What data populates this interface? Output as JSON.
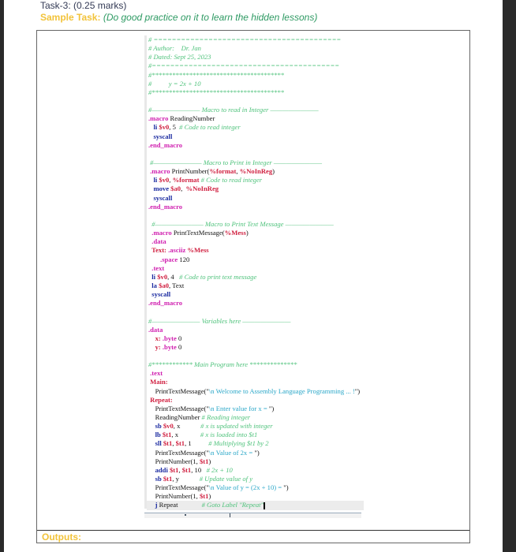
{
  "header": {
    "task_title": "Task-3: (0.25 marks)",
    "sample_label": "Sample Task:",
    "sample_note": "(Do good practice on it to learn the hidden lessons)"
  },
  "outputs_label": "Outputs:",
  "code_lines": [
    [
      [
        "c",
        "# ========================================="
      ]
    ],
    [
      [
        "c",
        "# Author:    Dr. Jan"
      ]
    ],
    [
      [
        "c",
        "# Dated: Sept 25, 2023"
      ]
    ],
    [
      [
        "c",
        "#========================================="
      ]
    ],
    [
      [
        "c",
        "#***************************************"
      ]
    ],
    [
      [
        "c",
        "#          y = 2x + 10"
      ]
    ],
    [
      [
        "c",
        "#***************************************"
      ]
    ],
    [],
    [
      [
        "c",
        "#———————— Macro to read in Integer ————————"
      ]
    ],
    [
      [
        "d",
        ".macro "
      ],
      [
        "p",
        "ReadingNumber"
      ]
    ],
    [
      [
        "p",
        "   "
      ],
      [
        "k",
        "li "
      ],
      [
        "r",
        "$v0"
      ],
      [
        "p",
        ", 5  "
      ],
      [
        "c",
        "# Code to read integer"
      ]
    ],
    [
      [
        "p",
        "   "
      ],
      [
        "k",
        "syscall"
      ]
    ],
    [
      [
        "d",
        ".end_macro"
      ]
    ],
    [],
    [
      [
        "c",
        " #———————— Macro to Print in Integer ————————"
      ]
    ],
    [
      [
        "d",
        " .macro "
      ],
      [
        "p",
        "PrintNumber("
      ],
      [
        "r",
        "%format"
      ],
      [
        "p",
        ", "
      ],
      [
        "r",
        "%NoInReg"
      ],
      [
        "p",
        ")"
      ]
    ],
    [
      [
        "p",
        "   "
      ],
      [
        "k",
        "li "
      ],
      [
        "r",
        "$v0"
      ],
      [
        "p",
        ", "
      ],
      [
        "r",
        "%format"
      ],
      [
        "c",
        " # Code to read integer"
      ]
    ],
    [
      [
        "p",
        "   "
      ],
      [
        "k",
        "move "
      ],
      [
        "r",
        "$a0"
      ],
      [
        "p",
        ",  "
      ],
      [
        "r",
        "%NoInReg"
      ]
    ],
    [
      [
        "p",
        "   "
      ],
      [
        "k",
        "syscall"
      ]
    ],
    [
      [
        "d",
        ".end_macro"
      ]
    ],
    [],
    [
      [
        "c",
        "  #———————— Macro to Print Text Message ————————"
      ]
    ],
    [
      [
        "d",
        "  .macro "
      ],
      [
        "p",
        "PrintTextMessage("
      ],
      [
        "r",
        "%Mess"
      ],
      [
        "p",
        ")"
      ]
    ],
    [
      [
        "d",
        "  .data"
      ]
    ],
    [
      [
        "r",
        "  Text: "
      ],
      [
        "d",
        ".asciiz "
      ],
      [
        "r",
        "%Mess"
      ]
    ],
    [
      [
        "d",
        "       .space "
      ],
      [
        "p",
        "120"
      ]
    ],
    [
      [
        "d",
        "  .text"
      ]
    ],
    [
      [
        "k",
        "  li "
      ],
      [
        "r",
        "$v0"
      ],
      [
        "p",
        ", 4   "
      ],
      [
        "c",
        "# Code to print text message"
      ]
    ],
    [
      [
        "k",
        "  la "
      ],
      [
        "r",
        "$a0"
      ],
      [
        "p",
        ", Text"
      ]
    ],
    [
      [
        "k",
        "  syscall"
      ]
    ],
    [
      [
        "d",
        ".end_macro"
      ]
    ],
    [],
    [
      [
        "c",
        "#———————— Variables here ————————"
      ]
    ],
    [
      [
        "d",
        ".data"
      ]
    ],
    [
      [
        "p",
        "    "
      ],
      [
        "r",
        "x: "
      ],
      [
        "d",
        ".byte "
      ],
      [
        "p",
        "0"
      ]
    ],
    [
      [
        "p",
        "    "
      ],
      [
        "r",
        "y: "
      ],
      [
        "d",
        ".byte "
      ],
      [
        "p",
        "0"
      ]
    ],
    [],
    [
      [
        "c",
        "#************ Main Program here **************"
      ]
    ],
    [
      [
        "d",
        " .text"
      ]
    ],
    [
      [
        "lbl",
        " Main:"
      ]
    ],
    [
      [
        "p",
        "    PrintTextMessage(\""
      ],
      [
        "s",
        "\\n Welcome to Assembly Language Programming ... !"
      ],
      [
        "p",
        "\")"
      ]
    ],
    [
      [
        "lbl",
        " Repeat:"
      ]
    ],
    [
      [
        "p",
        "    PrintTextMessage(\""
      ],
      [
        "s",
        "\\n Enter value for x = "
      ],
      [
        "p",
        "\")"
      ]
    ],
    [
      [
        "p",
        "    ReadingNumber "
      ],
      [
        "c",
        "# Reading integer"
      ]
    ],
    [
      [
        "p",
        "    "
      ],
      [
        "k",
        "sb "
      ],
      [
        "r",
        "$v0"
      ],
      [
        "p",
        ", x            "
      ],
      [
        "c",
        "# x is updated with integer"
      ]
    ],
    [
      [
        "p",
        "    "
      ],
      [
        "k",
        "lb "
      ],
      [
        "r",
        "$t1"
      ],
      [
        "p",
        ", x             "
      ],
      [
        "c",
        "# x is loaded into $t1"
      ]
    ],
    [
      [
        "p",
        "    "
      ],
      [
        "k",
        "sll "
      ],
      [
        "r",
        "$t1"
      ],
      [
        "p",
        ", "
      ],
      [
        "r",
        "$t1"
      ],
      [
        "p",
        ", 1          "
      ],
      [
        "c",
        "# Multiplying $t1 by 2"
      ]
    ],
    [
      [
        "p",
        "    PrintTextMessage(\""
      ],
      [
        "s",
        "\\n Value of 2x = "
      ],
      [
        "p",
        "\")"
      ]
    ],
    [
      [
        "p",
        "    PrintNumber(1, "
      ],
      [
        "r",
        "$t1"
      ],
      [
        "p",
        ")"
      ]
    ],
    [
      [
        "p",
        "    "
      ],
      [
        "k",
        "addi "
      ],
      [
        "r",
        "$t1"
      ],
      [
        "p",
        ", "
      ],
      [
        "r",
        "$t1"
      ],
      [
        "p",
        ", 10   "
      ],
      [
        "c",
        "# 2x + 10"
      ]
    ],
    [
      [
        "p",
        "    "
      ],
      [
        "k",
        "sb "
      ],
      [
        "r",
        "$t1"
      ],
      [
        "p",
        ", y            "
      ],
      [
        "c",
        "# Update value of y"
      ]
    ],
    [
      [
        "p",
        "    PrintTextMessage(\""
      ],
      [
        "s",
        "\\n Value of y = (2x + 10) = "
      ],
      [
        "p",
        "\")"
      ]
    ],
    [
      [
        "p",
        "    PrintNumber(1, "
      ],
      [
        "r",
        "$t1"
      ],
      [
        "p",
        ")"
      ]
    ],
    [
      [
        "k",
        "    j "
      ],
      [
        "p",
        "Repeat              "
      ],
      [
        "c",
        "# Goto Label \"Repeat\""
      ]
    ]
  ]
}
